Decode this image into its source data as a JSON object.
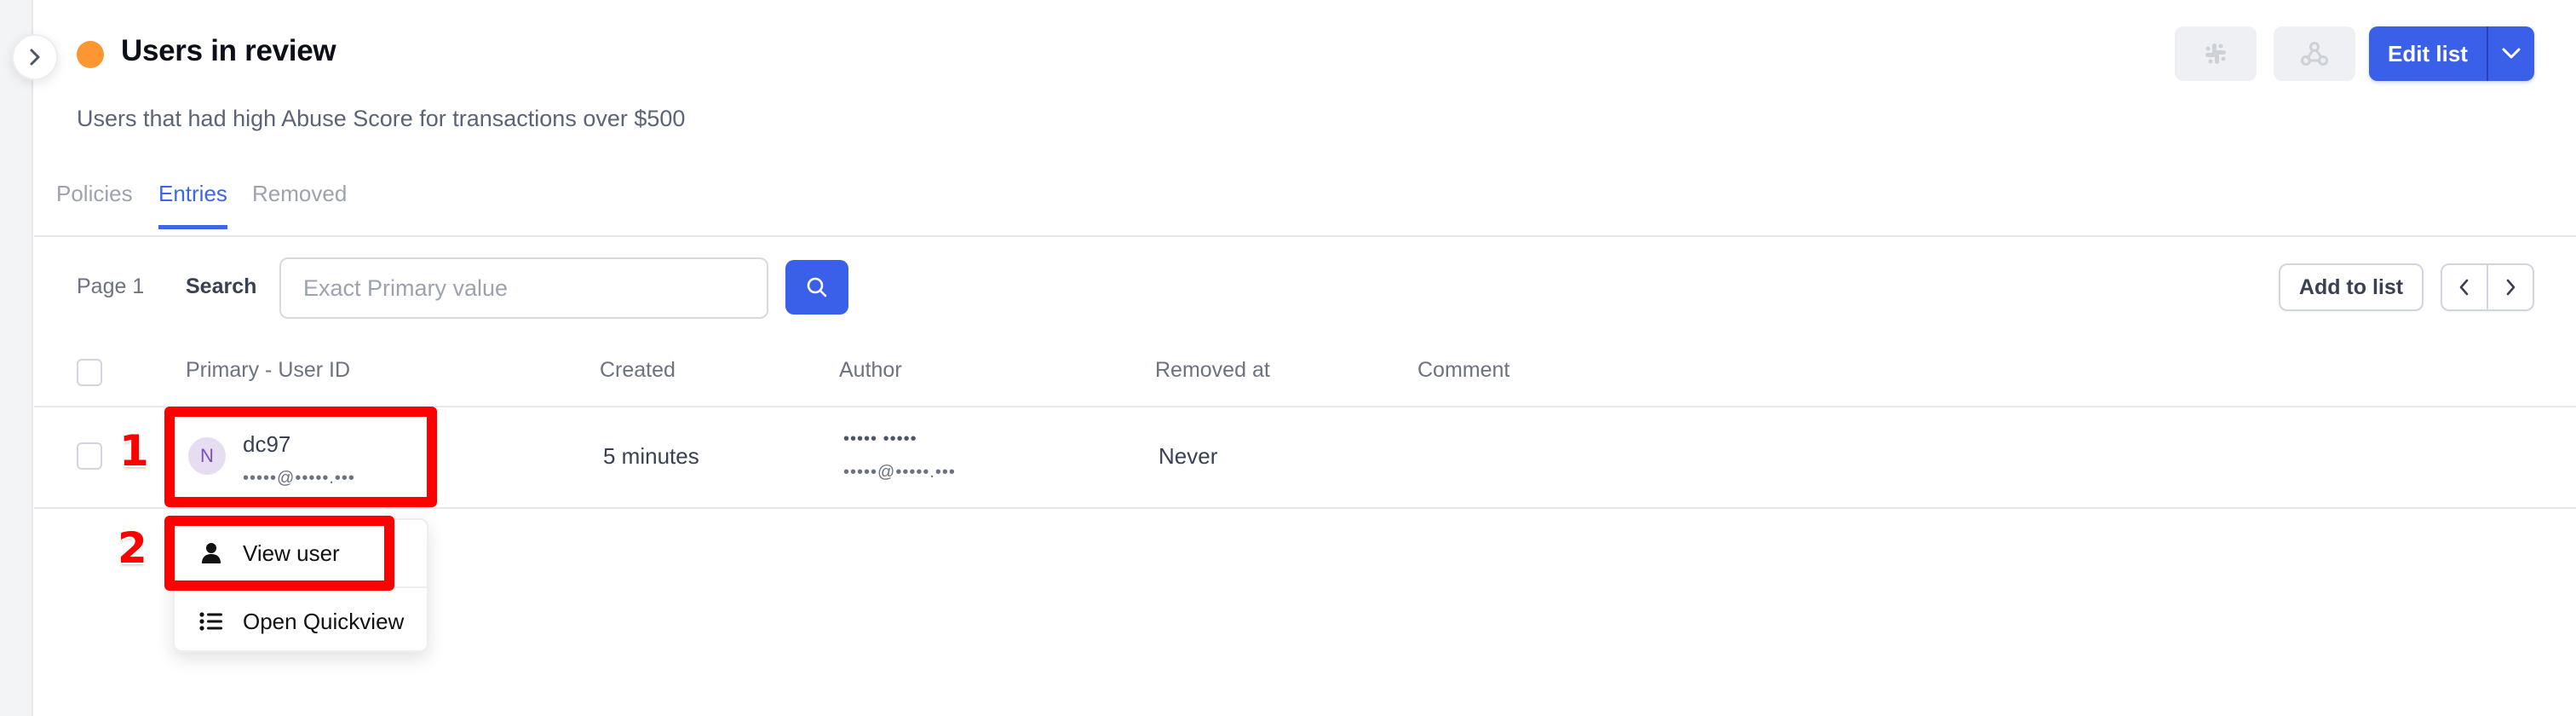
{
  "header": {
    "title": "Users in review",
    "status_color": "#fb9633",
    "subtitle": "Users that had high Abuse Score for transactions over $500",
    "slack_icon": "slack-icon",
    "webhook_icon": "webhook-icon",
    "edit_label": "Edit list",
    "edit_menu_icon": "chevron-down-icon"
  },
  "tabs": [
    {
      "label": "Policies",
      "active": false
    },
    {
      "label": "Entries",
      "active": true
    },
    {
      "label": "Removed",
      "active": false
    }
  ],
  "toolbar": {
    "page_label": "Page 1",
    "search_label": "Search",
    "search_placeholder": "Exact Primary value",
    "search_value": "",
    "search_icon": "search-icon",
    "add_label": "Add to list",
    "prev_icon": "chevron-left-icon",
    "next_icon": "chevron-right-icon"
  },
  "table": {
    "columns": [
      "Primary - User ID",
      "Created",
      "Author",
      "Removed at",
      "Comment"
    ],
    "rows": [
      {
        "avatar_initial": "N",
        "user_id": "dc97",
        "user_email": "•••••@•••••.•••",
        "created": "5 minutes",
        "author_name": "••••• •••••",
        "author_email": "•••••@•••••.•••",
        "removed_at": "Never",
        "comment": ""
      }
    ]
  },
  "context_menu": {
    "items": [
      {
        "label": "View user",
        "icon": "user-icon"
      },
      {
        "label": "Open Quickview",
        "icon": "list-icon"
      }
    ]
  },
  "annotations": {
    "accent": "#ff0000",
    "labels": [
      "1",
      "2"
    ]
  },
  "colors": {
    "primary": "#3a5fe8",
    "avatar_bg": "#e6ddf3",
    "avatar_fg": "#7c4dbd"
  }
}
